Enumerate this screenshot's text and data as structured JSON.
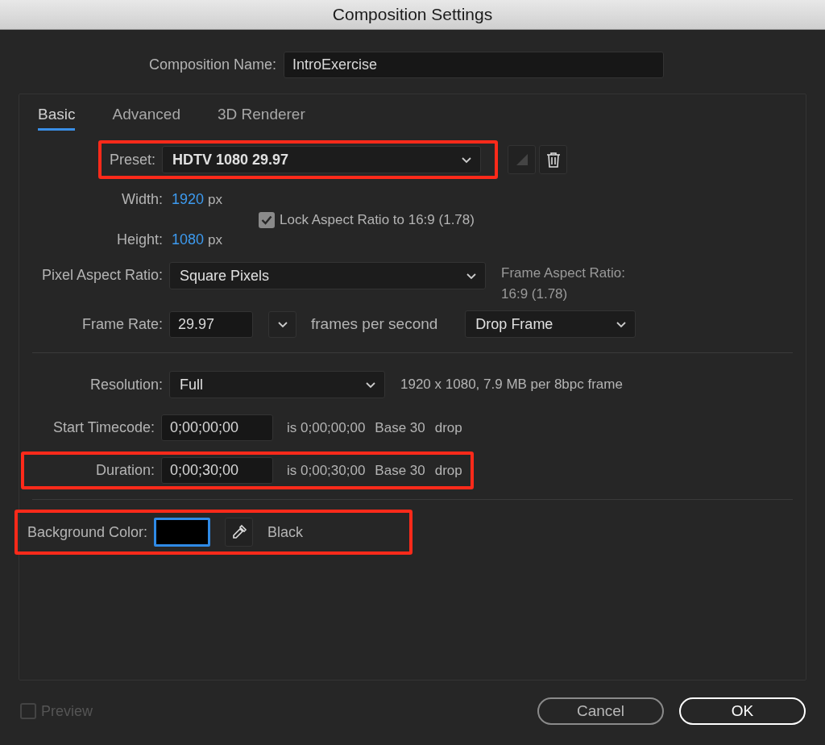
{
  "window": {
    "title": "Composition Settings"
  },
  "composition_name": {
    "label": "Composition Name:",
    "value": "IntroExercise"
  },
  "tabs": [
    {
      "label": "Basic",
      "selected": true
    },
    {
      "label": "Advanced",
      "selected": false
    },
    {
      "label": "3D Renderer",
      "selected": false
    }
  ],
  "preset": {
    "label": "Preset:",
    "value": "HDTV 1080 29.97",
    "highlighted": true
  },
  "width": {
    "label": "Width:",
    "value": "1920",
    "unit": "px"
  },
  "height": {
    "label": "Height:",
    "value": "1080",
    "unit": "px"
  },
  "lock_aspect": {
    "label": "Lock Aspect Ratio to 16:9 (1.78)",
    "checked": true
  },
  "pixel_aspect": {
    "label": "Pixel Aspect Ratio:",
    "value": "Square Pixels"
  },
  "frame_aspect": {
    "label": "Frame Aspect Ratio:",
    "value": "16:9 (1.78)"
  },
  "frame_rate": {
    "label": "Frame Rate:",
    "value": "29.97",
    "unit_label": "frames per second",
    "mode": "Drop Frame"
  },
  "resolution": {
    "label": "Resolution:",
    "value": "Full",
    "info": "1920 x 1080, 7.9 MB per 8bpc frame"
  },
  "start_timecode": {
    "label": "Start Timecode:",
    "value": "0;00;00;00",
    "info": [
      "is 0;00;00;00",
      "Base 30",
      "drop"
    ],
    "highlighted": false
  },
  "duration": {
    "label": "Duration:",
    "value": "0;00;30;00",
    "info": [
      "is 0;00;30;00",
      "Base 30",
      "drop"
    ],
    "highlighted": true
  },
  "background": {
    "label": "Background Color:",
    "color": "#000000",
    "name": "Black",
    "highlighted": true
  },
  "preview": {
    "label": "Preview",
    "checked": false,
    "disabled": true
  },
  "buttons": [
    {
      "label": "Cancel",
      "kind": "secondary"
    },
    {
      "label": "OK",
      "kind": "primary"
    }
  ]
}
